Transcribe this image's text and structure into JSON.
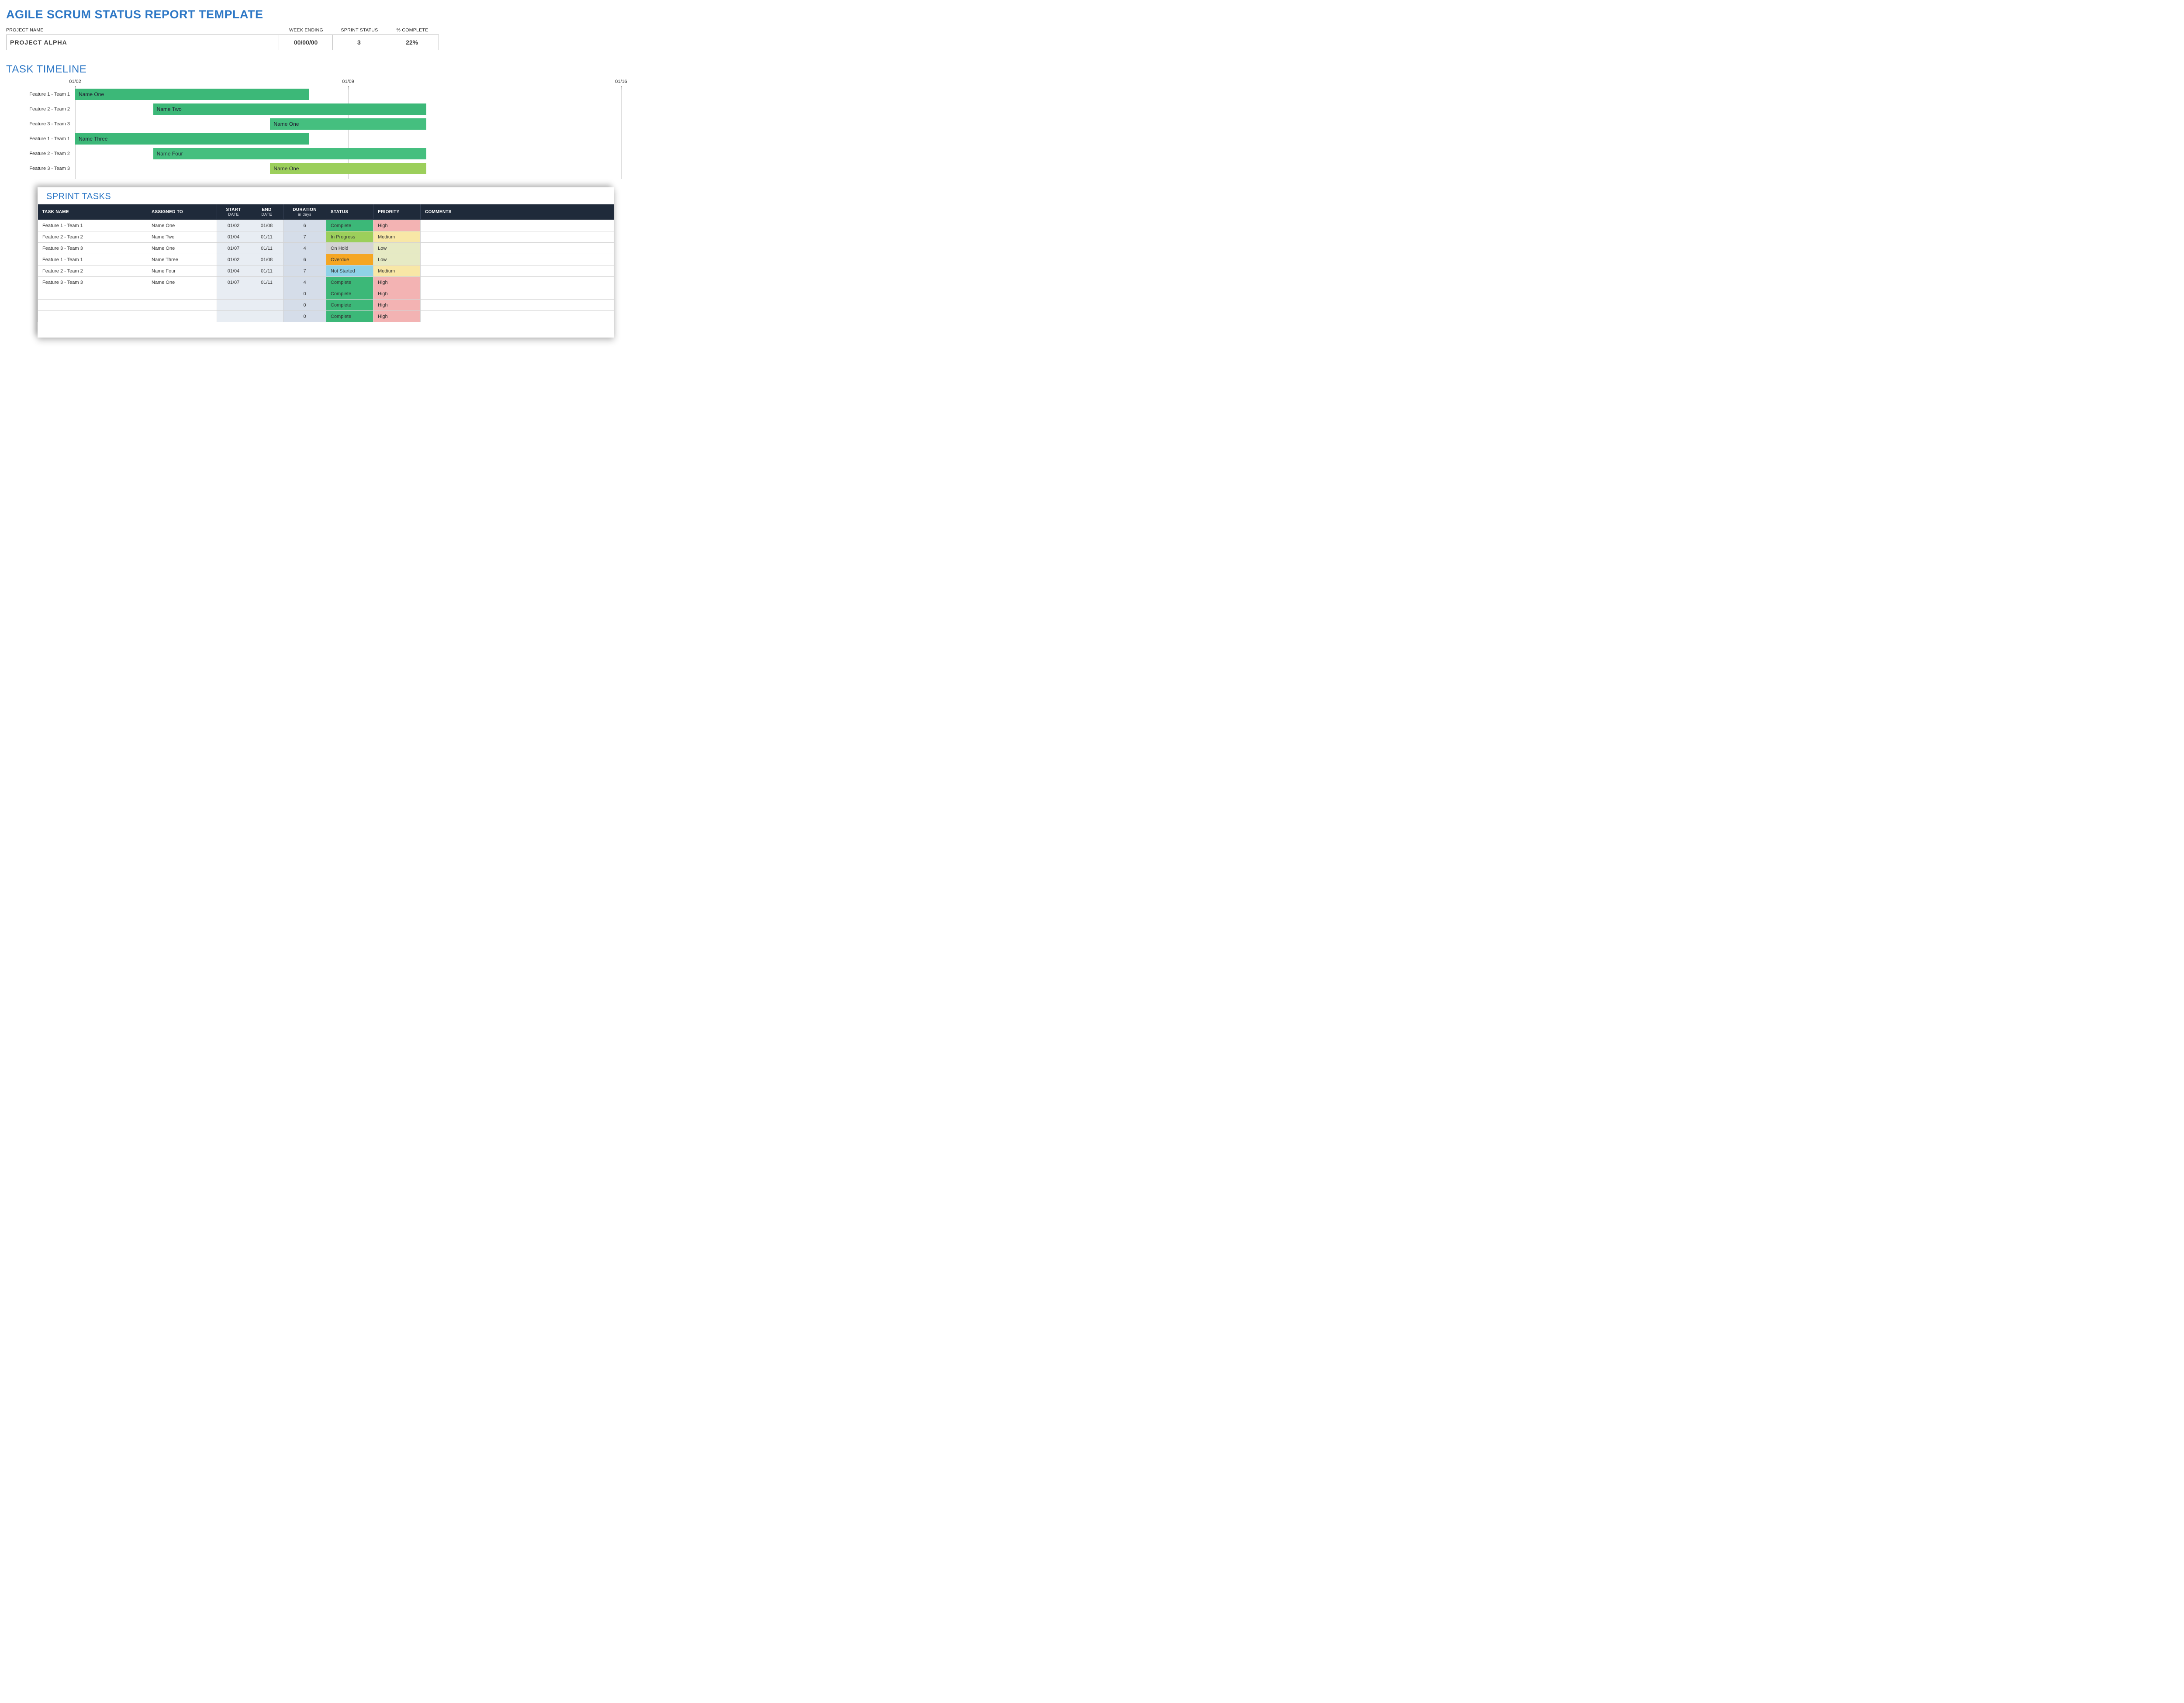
{
  "title": "AGILE SCRUM STATUS REPORT TEMPLATE",
  "meta": {
    "labels": {
      "project": "PROJECT NAME",
      "week": "WEEK ENDING",
      "sprint": "SPRINT STATUS",
      "pct": "% COMPLETE"
    },
    "values": {
      "project": "PROJECT ALPHA",
      "week": "00/00/00",
      "sprint": "3",
      "pct": "22%"
    }
  },
  "timeline_title": "TASK TIMELINE",
  "chart_data": {
    "type": "bar",
    "title": "TASK TIMELINE",
    "xlabel": "",
    "ylabel": "",
    "x_ticks": [
      "01/02",
      "01/09",
      "01/16"
    ],
    "categories": [
      "Feature 1 - Team 1",
      "Feature 2 - Team 2",
      "Feature 3 - Team 3",
      "Feature 1 - Team 1",
      "Feature 2 - Team 2",
      "Feature 3 - Team 3"
    ],
    "bars": [
      {
        "label": "Name One",
        "start": "01/02",
        "end": "01/08",
        "start_day": 0,
        "duration_days": 6,
        "color": "green"
      },
      {
        "label": "Name Two",
        "start": "01/04",
        "end": "01/11",
        "start_day": 2,
        "duration_days": 7,
        "color": "green"
      },
      {
        "label": "Name One",
        "start": "01/07",
        "end": "01/11",
        "start_day": 5,
        "duration_days": 4,
        "color": "green2"
      },
      {
        "label": "Name Three",
        "start": "01/02",
        "end": "01/08",
        "start_day": 0,
        "duration_days": 6,
        "color": "green"
      },
      {
        "label": "Name Four",
        "start": "01/04",
        "end": "01/11",
        "start_day": 2,
        "duration_days": 7,
        "color": "green2"
      },
      {
        "label": "Name One",
        "start": "01/07",
        "end": "01/11",
        "start_day": 5,
        "duration_days": 4,
        "color": "lime"
      }
    ],
    "xlim_days": [
      0,
      14
    ]
  },
  "sprint": {
    "title": "SPRINT TASKS",
    "headers": {
      "task": "TASK NAME",
      "assigned": "ASSIGNED TO",
      "start": "START",
      "start_sub": "DATE",
      "end": "END",
      "end_sub": "DATE",
      "duration": "DURATION",
      "duration_sub": "in days",
      "status": "STATUS",
      "priority": "PRIORITY",
      "comments": "COMMENTS"
    },
    "rows": [
      {
        "task": "Feature 1 - Team 1",
        "assigned": "Name One",
        "start": "01/02",
        "end": "01/08",
        "dur": "6",
        "status": "Complete",
        "status_cls": "st-complete",
        "prio": "High",
        "prio_cls": "pr-high",
        "comments": ""
      },
      {
        "task": "Feature 2 - Team 2",
        "assigned": "Name Two",
        "start": "01/04",
        "end": "01/11",
        "dur": "7",
        "status": "In Progress",
        "status_cls": "st-inprogress",
        "prio": "Medium",
        "prio_cls": "pr-medium",
        "comments": ""
      },
      {
        "task": "Feature 3 - Team 3",
        "assigned": "Name One",
        "start": "01/07",
        "end": "01/11",
        "dur": "4",
        "status": "On Hold",
        "status_cls": "st-onhold",
        "prio": "Low",
        "prio_cls": "pr-low",
        "comments": ""
      },
      {
        "task": "Feature 1 - Team 1",
        "assigned": "Name Three",
        "start": "01/02",
        "end": "01/08",
        "dur": "6",
        "status": "Overdue",
        "status_cls": "st-overdue",
        "prio": "Low",
        "prio_cls": "pr-low",
        "comments": ""
      },
      {
        "task": "Feature 2 - Team 2",
        "assigned": "Name Four",
        "start": "01/04",
        "end": "01/11",
        "dur": "7",
        "status": "Not Started",
        "status_cls": "st-notstarted",
        "prio": "Medium",
        "prio_cls": "pr-medium",
        "comments": ""
      },
      {
        "task": "Feature 3 - Team 3",
        "assigned": "Name One",
        "start": "01/07",
        "end": "01/11",
        "dur": "4",
        "status": "Complete",
        "status_cls": "st-complete",
        "prio": "High",
        "prio_cls": "pr-high",
        "comments": ""
      },
      {
        "task": "",
        "assigned": "",
        "start": "",
        "end": "",
        "dur": "0",
        "status": "Complete",
        "status_cls": "st-complete",
        "prio": "High",
        "prio_cls": "pr-high",
        "comments": ""
      },
      {
        "task": "",
        "assigned": "",
        "start": "",
        "end": "",
        "dur": "0",
        "status": "Complete",
        "status_cls": "st-complete",
        "prio": "High",
        "prio_cls": "pr-high",
        "comments": ""
      },
      {
        "task": "",
        "assigned": "",
        "start": "",
        "end": "",
        "dur": "0",
        "status": "Complete",
        "status_cls": "st-complete",
        "prio": "High",
        "prio_cls": "pr-high",
        "comments": ""
      }
    ]
  }
}
